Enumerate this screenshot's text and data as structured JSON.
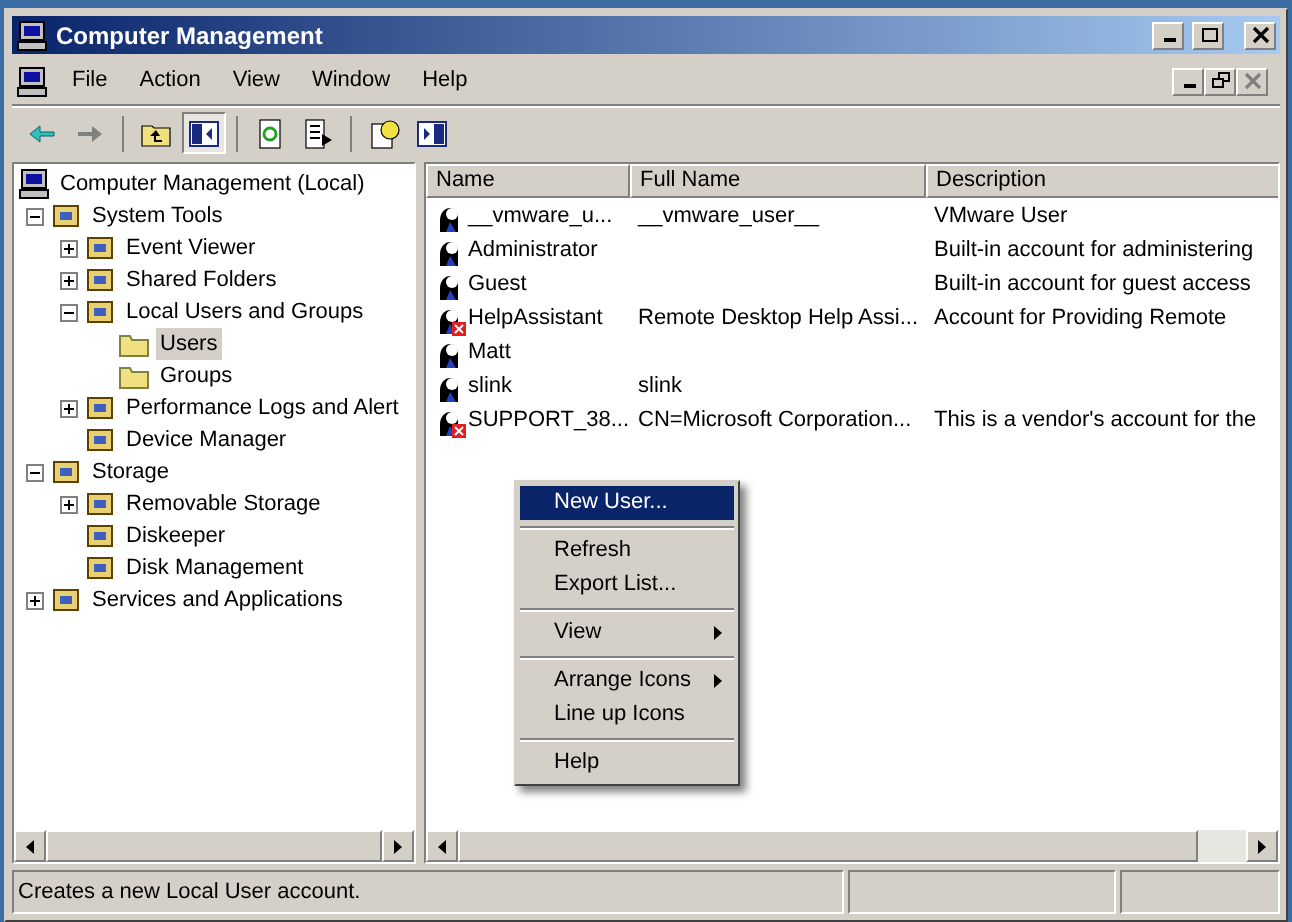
{
  "window": {
    "title": "Computer Management"
  },
  "menu_bar": [
    "File",
    "Action",
    "View",
    "Window",
    "Help"
  ],
  "tree": [
    {
      "label": "Computer Management (Local)",
      "kind": "root",
      "selected": false,
      "children": [
        {
          "label": "System Tools",
          "kind": "branch",
          "expanded": true,
          "selected": false,
          "children": [
            {
              "label": "Event Viewer",
              "kind": "branch",
              "expanded": false,
              "selected": false
            },
            {
              "label": "Shared Folders",
              "kind": "branch",
              "expanded": false,
              "selected": false
            },
            {
              "label": "Local Users and Groups",
              "kind": "branch",
              "expanded": true,
              "selected": false,
              "children": [
                {
                  "label": "Users",
                  "kind": "leaf",
                  "selected": true
                },
                {
                  "label": "Groups",
                  "kind": "leaf",
                  "selected": false
                }
              ]
            },
            {
              "label": "Performance Logs and Alert",
              "kind": "branch",
              "expanded": false,
              "selected": false
            },
            {
              "label": "Device Manager",
              "kind": "leaf",
              "selected": false
            }
          ]
        },
        {
          "label": "Storage",
          "kind": "branch",
          "expanded": true,
          "selected": false,
          "children": [
            {
              "label": "Removable Storage",
              "kind": "branch",
              "expanded": false,
              "selected": false
            },
            {
              "label": "Diskeeper",
              "kind": "leaf",
              "selected": false
            },
            {
              "label": "Disk Management",
              "kind": "leaf",
              "selected": false
            }
          ]
        },
        {
          "label": "Services and Applications",
          "kind": "branch",
          "expanded": false,
          "selected": false
        }
      ]
    }
  ],
  "table": {
    "columns": [
      "Name",
      "Full Name",
      "Description"
    ],
    "rows": [
      {
        "name": "__vmware_u...",
        "full_name": "__vmware_user__",
        "description": "VMware User",
        "disabled": false
      },
      {
        "name": "Administrator",
        "description": "Built-in account for administering",
        "disabled": false
      },
      {
        "name": "Guest",
        "description": "Built-in account for guest access",
        "disabled": false
      },
      {
        "name": "HelpAssistant",
        "full_name": "Remote Desktop Help Assi...",
        "description": "Account for Providing Remote",
        "disabled": true
      },
      {
        "name": "Matt",
        "disabled": false
      },
      {
        "name": "slink",
        "full_name": "slink",
        "disabled": false
      },
      {
        "name": "SUPPORT_38...",
        "full_name": "CN=Microsoft Corporation...",
        "description": "This is a vendor's account for the",
        "disabled": true
      }
    ]
  },
  "context_menu": [
    [
      {
        "label": "New User...",
        "selected": true,
        "submenu": false
      }
    ],
    [
      {
        "label": "Refresh",
        "selected": false,
        "submenu": false
      },
      {
        "label": "Export List...",
        "selected": false,
        "submenu": false
      }
    ],
    [
      {
        "label": "View",
        "selected": false,
        "submenu": true
      }
    ],
    [
      {
        "label": "Arrange Icons",
        "selected": false,
        "submenu": true
      },
      {
        "label": "Line up Icons",
        "selected": false,
        "submenu": false
      }
    ],
    [
      {
        "label": "Help",
        "selected": false,
        "submenu": false
      }
    ]
  ],
  "status_bar": "Creates a new Local User account."
}
